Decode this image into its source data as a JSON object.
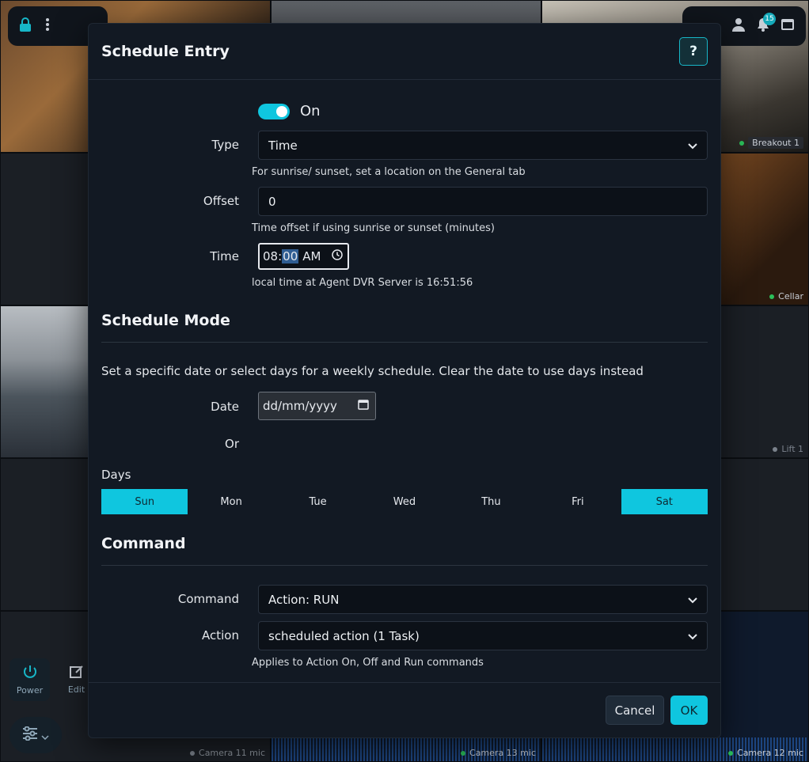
{
  "background": {
    "cameras": [
      {
        "label": "Breakout 1"
      },
      {
        "label": "Cellar"
      },
      {
        "label": "Lift 1"
      },
      {
        "label": "Camera 11 mic"
      },
      {
        "label": "Camera 13 mic"
      },
      {
        "label": "Camera 12 mic"
      }
    ],
    "notification_count": "15",
    "tools": {
      "power": "Power",
      "edit": "Edit"
    }
  },
  "modal": {
    "title": "Schedule Entry",
    "help_label": "?",
    "enabled_label": "On",
    "type": {
      "label": "Type",
      "value": "Time",
      "help": "For sunrise/ sunset, set a location on the General tab"
    },
    "offset": {
      "label": "Offset",
      "value": "0",
      "help": "Time offset if using sunrise or sunset (minutes)"
    },
    "time": {
      "label": "Time",
      "hours": "08",
      "sep": ":",
      "minutes": "00",
      "ampm": "AM",
      "help": "local time at Agent DVR Server is 16:51:56"
    },
    "schedule_mode": {
      "title": "Schedule Mode",
      "description": "Set a specific date or select days for a weekly schedule. Clear the date to use days instead",
      "date_label": "Date",
      "date_placeholder": "dd/mm/yyyy",
      "or_label": "Or",
      "days_label": "Days",
      "days": [
        {
          "label": "Sun",
          "selected": true
        },
        {
          "label": "Mon",
          "selected": false
        },
        {
          "label": "Tue",
          "selected": false
        },
        {
          "label": "Wed",
          "selected": false
        },
        {
          "label": "Thu",
          "selected": false
        },
        {
          "label": "Fri",
          "selected": false
        },
        {
          "label": "Sat",
          "selected": true
        }
      ]
    },
    "command": {
      "title": "Command",
      "command_label": "Command",
      "command_value": "Action: RUN",
      "action_label": "Action",
      "action_value": "scheduled action (1 Task)",
      "help": "Applies to Action On, Off and Run commands"
    },
    "footer": {
      "cancel": "Cancel",
      "ok": "OK"
    }
  },
  "colors": {
    "accent": "#0fc6df",
    "panel": "#121923",
    "field": "#0c1118"
  }
}
